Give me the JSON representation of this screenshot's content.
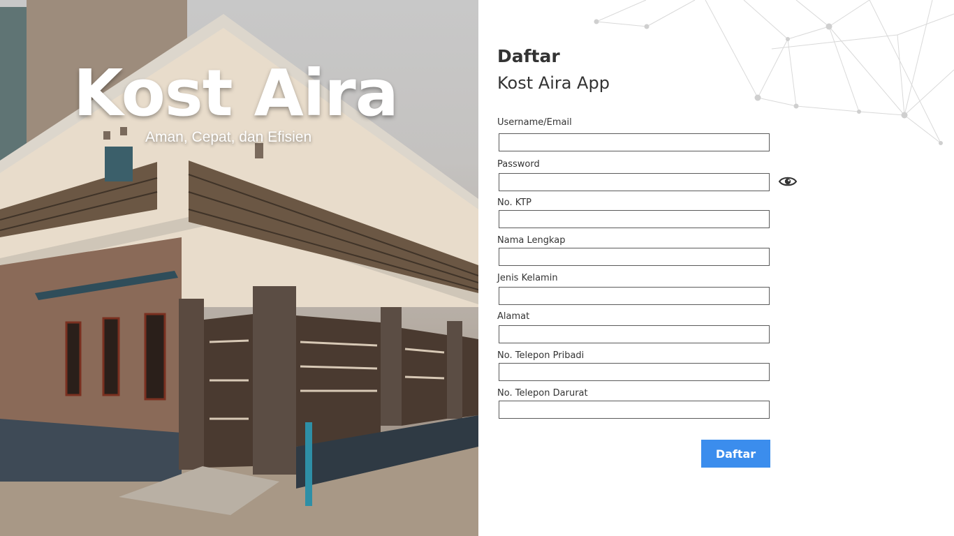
{
  "hero": {
    "title": "Kost Aira",
    "subtitle": "Aman, Cepat, dan Efisien"
  },
  "form": {
    "heading": "Daftar",
    "subheading": "Kost Aira App",
    "fields": [
      {
        "label": "Username/Email",
        "value": ""
      },
      {
        "label": "Password",
        "value": ""
      },
      {
        "label": "No. KTP",
        "value": ""
      },
      {
        "label": "Nama Lengkap",
        "value": ""
      },
      {
        "label": "Jenis Kelamin",
        "value": ""
      },
      {
        "label": "Alamat",
        "value": ""
      },
      {
        "label": "No. Telepon Pribadi",
        "value": ""
      },
      {
        "label": "No. Telepon Darurat",
        "value": ""
      }
    ],
    "password_toggle_icon": "eye-icon",
    "submit_label": "Daftar"
  },
  "colors": {
    "accent": "#3b8ded",
    "text": "#333333",
    "input_border": "#5a5a5a"
  }
}
